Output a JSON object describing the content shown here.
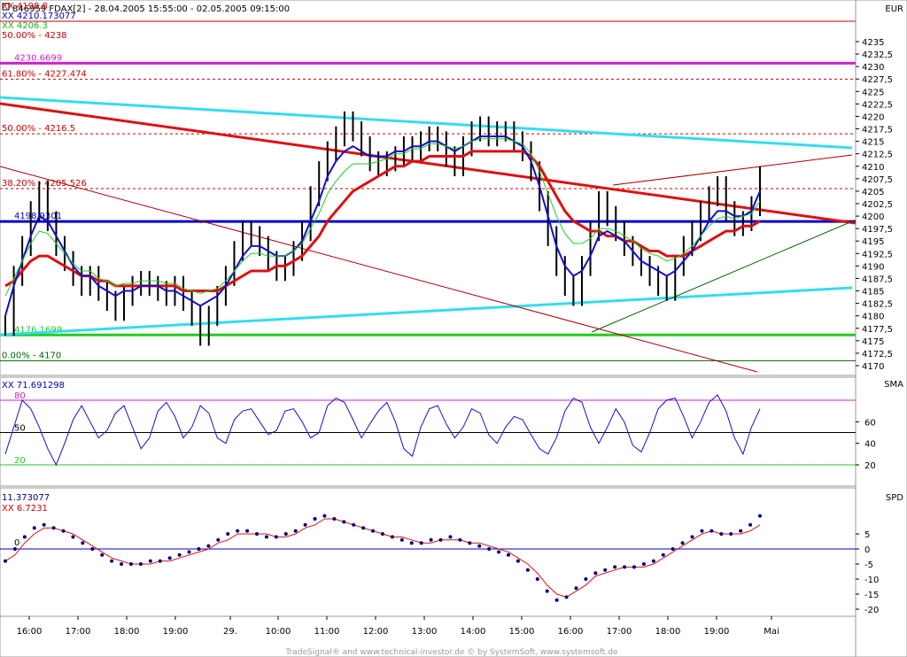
{
  "header": {
    "title": "846959  FDAX[2] - 28.04.2005 15:55:00 - 02.05.2005 09:15:00",
    "currency": "EUR"
  },
  "footer": "TradeSignal® and www.technical-investor.de © by  SystemSoft,  www.systemsoft.de",
  "colors": {
    "red": "#dd1111",
    "cyan": "#33ddee",
    "blue": "#1111cc",
    "green": "#22cc22",
    "magenta": "#cc22cc",
    "darkred": "#aa0000",
    "navy": "#000080",
    "darkgreen": "#006600"
  },
  "panels": {
    "sma_label": "SMA",
    "spd_label": "SPD"
  },
  "chart_data": [
    {
      "type": "line",
      "title": "846959  FDAX[2] - 28.04.2005 15:55:00 - 02.05.2005 09:15:00",
      "x_ticks": [
        "16:00",
        "17:00",
        "18:00",
        "19:00",
        "29.",
        "10:00",
        "11:00",
        "12:00",
        "13:00",
        "14:00",
        "15:00",
        "16:00",
        "17:00",
        "18:00",
        "19:00",
        "Mai"
      ],
      "ylim": [
        4169,
        4240
      ],
      "y_ticks": [
        "4235",
        "4232,5",
        "4230",
        "4227,5",
        "4225",
        "4222,5",
        "4220",
        "4217,5",
        "4215",
        "4212,5",
        "4210",
        "4207,5",
        "4205",
        "4202,5",
        "4200",
        "4197,5",
        "4195",
        "4192,5",
        "4190",
        "4187,5",
        "4185",
        "4182,5",
        "4180",
        "4177,5",
        "4175",
        "4172,5",
        "4170"
      ],
      "legend": [
        {
          "text": "XX 4198.8",
          "color": "#cc0000"
        },
        {
          "text": "XX 4210.173077",
          "color": "#0000aa"
        },
        {
          "text": "XX 4206.3",
          "color": "#22aa22"
        },
        {
          "text": "50.00% - 4238",
          "color": "#cc0000"
        }
      ],
      "price_levels": [
        {
          "label": "4230.6699",
          "value": 4230.67,
          "color": "#cc22cc"
        },
        {
          "label": "61.80% - 4227.474",
          "value": 4227.474,
          "color": "#cc0000"
        },
        {
          "label": "50.00% - 4216.5",
          "value": 4216.5,
          "color": "#cc0000"
        },
        {
          "label": "38.20% - 4205.526",
          "value": 4205.526,
          "color": "#cc0000"
        },
        {
          "label": "4198.9301",
          "value": 4198.93,
          "color": "#0000cc"
        },
        {
          "label": "4176.1699",
          "value": 4176.17,
          "color": "#22cc22"
        },
        {
          "label": "0.00% - 4170",
          "value": 4171.0,
          "color": "#006600"
        }
      ],
      "close_series": [
        4178,
        4188,
        4194,
        4201,
        4205,
        4199,
        4194,
        4191,
        4188,
        4186,
        4188,
        4185,
        4183,
        4181,
        4184,
        4186,
        4187,
        4186,
        4185,
        4184,
        4186,
        4183,
        4180,
        4176,
        4180,
        4184,
        4188,
        4193,
        4197,
        4196,
        4194,
        4191,
        4189,
        4190,
        4193,
        4197,
        4204,
        4209,
        4213,
        4216,
        4219,
        4217,
        4214,
        4211,
        4210,
        4211,
        4212,
        4214,
        4213,
        4215,
        4216,
        4215,
        4212,
        4210,
        4214,
        4217,
        4218,
        4216,
        4217,
        4217,
        4215,
        4213,
        4209,
        4203,
        4196,
        4190,
        4186,
        4184,
        4190,
        4197,
        4203,
        4200,
        4197,
        4194,
        4192,
        4190,
        4188,
        4186,
        4185,
        4190,
        4194,
        4197,
        4201,
        4204,
        4206,
        4201,
        4198,
        4199,
        4202,
        4208
      ],
      "fast_ma": [
        4180,
        4186,
        4191,
        4196,
        4200,
        4199,
        4196,
        4193,
        4190,
        4188,
        4188,
        4186,
        4185,
        4184,
        4185,
        4185,
        4186,
        4186,
        4186,
        4185,
        4185,
        4184,
        4183,
        4182,
        4183,
        4184,
        4186,
        4189,
        4192,
        4194,
        4194,
        4193,
        4192,
        4192,
        4193,
        4195,
        4199,
        4203,
        4208,
        4211,
        4213,
        4214,
        4213,
        4212,
        4212,
        4212,
        4213,
        4213,
        4214,
        4214,
        4215,
        4215,
        4214,
        4213,
        4214,
        4215,
        4216,
        4216,
        4216,
        4216,
        4215,
        4214,
        4211,
        4206,
        4200,
        4194,
        4190,
        4188,
        4189,
        4192,
        4196,
        4197,
        4196,
        4195,
        4193,
        4191,
        4190,
        4189,
        4188,
        4189,
        4191,
        4193,
        4196,
        4199,
        4201,
        4201,
        4200,
        4200,
        4201,
        4205
      ],
      "slow_ma": [
        4186,
        4187,
        4189,
        4191,
        4192,
        4192,
        4191,
        4190,
        4189,
        4188,
        4188,
        4187,
        4187,
        4186,
        4186,
        4186,
        4186,
        4186,
        4186,
        4186,
        4186,
        4185,
        4185,
        4185,
        4185,
        4185,
        4186,
        4187,
        4188,
        4189,
        4189,
        4189,
        4190,
        4190,
        4191,
        4192,
        4194,
        4196,
        4199,
        4201,
        4203,
        4205,
        4206,
        4207,
        4208,
        4209,
        4210,
        4210,
        4211,
        4211,
        4212,
        4212,
        4212,
        4212,
        4212,
        4213,
        4213,
        4213,
        4213,
        4213,
        4213,
        4213,
        4212,
        4210,
        4207,
        4204,
        4201,
        4199,
        4198,
        4197,
        4197,
        4196,
        4196,
        4195,
        4195,
        4194,
        4193,
        4193,
        4192,
        4192,
        4192,
        4193,
        4194,
        4195,
        4196,
        4197,
        4197,
        4198,
        4198,
        4199
      ]
    },
    {
      "type": "line",
      "legend": [
        {
          "text": "XX 71.691298",
          "color": "#0000aa"
        }
      ],
      "ylim": [
        0,
        100
      ],
      "levels": [
        {
          "label": "80",
          "value": 80
        },
        {
          "label": "50",
          "value": 50
        },
        {
          "label": "20",
          "value": 20
        }
      ],
      "y_ticks": [
        "60",
        "40",
        "20"
      ],
      "values": [
        30,
        55,
        80,
        72,
        55,
        35,
        20,
        40,
        62,
        75,
        60,
        45,
        52,
        68,
        75,
        55,
        35,
        45,
        70,
        78,
        65,
        45,
        55,
        75,
        68,
        45,
        40,
        62,
        70,
        72,
        60,
        48,
        52,
        70,
        72,
        60,
        45,
        50,
        75,
        82,
        78,
        62,
        45,
        58,
        70,
        78,
        60,
        35,
        28,
        55,
        72,
        75,
        58,
        45,
        55,
        72,
        68,
        48,
        40,
        55,
        65,
        62,
        48,
        35,
        30,
        45,
        70,
        82,
        78,
        55,
        40,
        55,
        72,
        60,
        38,
        32,
        50,
        72,
        80,
        82,
        65,
        45,
        60,
        78,
        85,
        70,
        45,
        30,
        55,
        72
      ]
    },
    {
      "type": "line",
      "legend": [
        {
          "text": "11.373077",
          "color": "#000080"
        },
        {
          "text": "XX 6.7231",
          "color": "#cc0000"
        }
      ],
      "ylim": [
        -22,
        13
      ],
      "zero_label": "0",
      "y_ticks": [
        "5",
        "0",
        "-5",
        "-10",
        "-15",
        "-20"
      ],
      "dots": [
        -4,
        0,
        4,
        7,
        8,
        7,
        6,
        4,
        2,
        0,
        -2,
        -4,
        -5,
        -5,
        -5,
        -4,
        -4,
        -3,
        -2,
        -1,
        0,
        1,
        3,
        5,
        6,
        6,
        5,
        4,
        4,
        5,
        6,
        8,
        10,
        11,
        10,
        9,
        8,
        7,
        6,
        5,
        4,
        3,
        2,
        2,
        3,
        3,
        4,
        3,
        2,
        1,
        0,
        -1,
        -2,
        -4,
        -7,
        -10,
        -14,
        -17,
        -16,
        -13,
        -10,
        -8,
        -7,
        -6,
        -6,
        -6,
        -5,
        -4,
        -2,
        0,
        2,
        4,
        6,
        6,
        5,
        5,
        6,
        8,
        11
      ],
      "signal": [
        -4,
        -2,
        2,
        5,
        7,
        7,
        6,
        5,
        3,
        1,
        -1,
        -3,
        -4,
        -5,
        -5,
        -5,
        -4,
        -4,
        -3,
        -2,
        -1,
        0,
        2,
        3,
        5,
        5,
        5,
        5,
        4,
        4,
        5,
        7,
        8,
        10,
        10,
        9,
        8,
        7,
        6,
        5,
        4,
        4,
        3,
        2,
        2,
        3,
        3,
        3,
        2,
        2,
        1,
        0,
        -1,
        -3,
        -5,
        -8,
        -12,
        -15,
        -16,
        -14,
        -12,
        -9,
        -8,
        -7,
        -6,
        -6,
        -6,
        -5,
        -3,
        -1,
        1,
        3,
        5,
        6,
        5,
        5,
        5,
        6,
        8
      ]
    }
  ]
}
